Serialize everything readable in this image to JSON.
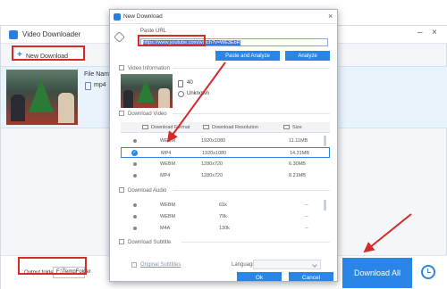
{
  "main_window": {
    "title": "Video Downloader",
    "new_download_label": "New Download",
    "file_name_label": "File Name:",
    "format": "mp4",
    "output_folder_label": "Output folder:",
    "output_folder_value": "F:\\TempFolder",
    "download_all_label": "Download All"
  },
  "dialog": {
    "title": "New Download",
    "paste_url_label": "Paste URL",
    "url_value": "https://www.youtube.com/watch?v=WE3EbR",
    "paste_analyze_label": "Paste and Analyze",
    "analyze_label": "Analyze",
    "video_info": {
      "heading": "Video Information",
      "count": "40",
      "duration": "Unknown"
    },
    "download_video": {
      "heading": "Download Video",
      "columns": [
        "Download Format",
        "Download Resolution",
        "Size"
      ],
      "rows": [
        {
          "format": "WEBM",
          "resolution": "1920x1080",
          "size": "11.11MB",
          "selected": false
        },
        {
          "format": "MP4",
          "resolution": "1920x1080",
          "size": "14.31MB",
          "selected": true
        },
        {
          "format": "WEBM",
          "resolution": "1280x720",
          "size": "6.30MB",
          "selected": false
        },
        {
          "format": "MP4",
          "resolution": "1280x720",
          "size": "8.21MB",
          "selected": false
        }
      ]
    },
    "download_audio": {
      "heading": "Download Audio",
      "rows": [
        {
          "format": "WEBM",
          "rate": "61k",
          "size": "--"
        },
        {
          "format": "WEBM",
          "rate": "79k",
          "size": "--"
        },
        {
          "format": "M4A",
          "rate": "130k",
          "size": "--"
        }
      ]
    },
    "download_subtitle": {
      "heading": "Download Subtitle",
      "original_subtitles": "Original Subtitles",
      "language_label": "Language"
    },
    "ok_label": "Ok",
    "cancel_label": "Cancel"
  },
  "colors": {
    "accent": "#2a86e6",
    "annotation_red": "#d42b2b"
  }
}
